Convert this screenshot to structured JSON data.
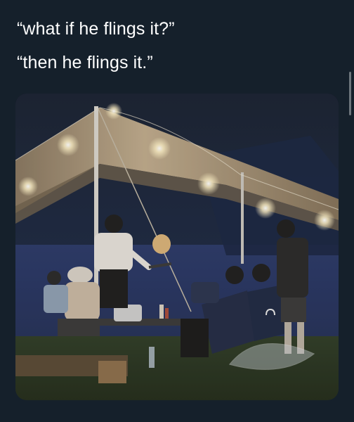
{
  "tweet": {
    "caption_line_1": "“what if he flings it?”",
    "caption_line_2": "“then he flings it.”"
  },
  "media": {
    "accent_colors": {
      "background": "#15202b",
      "text": "#ffffff",
      "scrollbar": "#6e767d",
      "tarp": "#b9a384",
      "lights": "#fff2c8",
      "grass": "#2b3a22"
    }
  }
}
